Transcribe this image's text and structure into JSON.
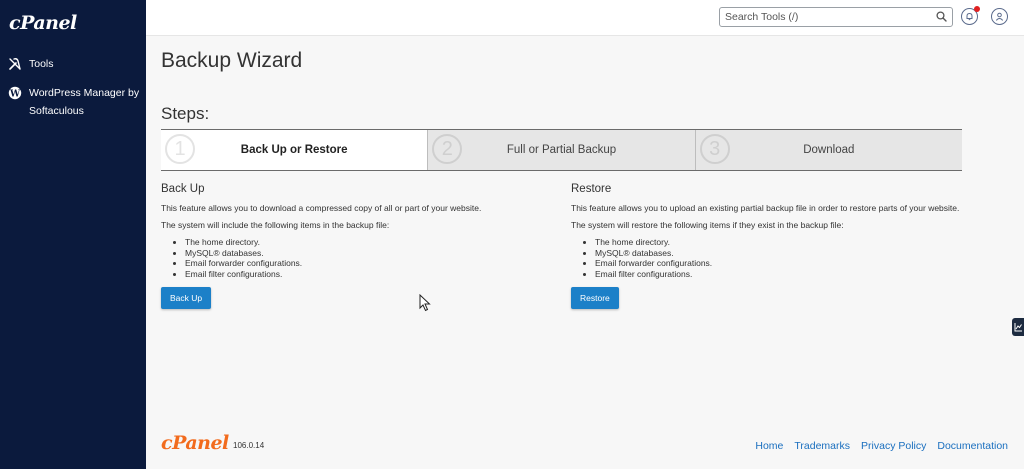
{
  "brand": {
    "logo_text": "cPanel"
  },
  "sidebar": {
    "items": [
      {
        "label": "Tools",
        "icon": "tools-icon"
      },
      {
        "label": "WordPress Manager by Softaculous",
        "icon": "wordpress-icon"
      }
    ]
  },
  "topbar": {
    "search_placeholder": "Search Tools (/)",
    "search_value": "",
    "notifications_has_badge": true,
    "colors": {
      "badge": "#e02020"
    }
  },
  "page": {
    "title": "Backup Wizard",
    "steps_heading": "Steps:",
    "steps": [
      {
        "number": "1",
        "label": "Back Up or Restore",
        "active": true
      },
      {
        "number": "2",
        "label": "Full or Partial Backup",
        "active": false
      },
      {
        "number": "3",
        "label": "Download",
        "active": false
      }
    ],
    "backup": {
      "heading": "Back Up",
      "description": "This feature allows you to download a compressed copy of all or part of your website.",
      "includes_intro": "The system will include the following items in the backup file:",
      "items": [
        "The home directory.",
        "MySQL® databases.",
        "Email forwarder configurations.",
        "Email filter configurations."
      ],
      "button_label": "Back Up"
    },
    "restore": {
      "heading": "Restore",
      "description": "This feature allows you to upload an existing partial backup file in order to restore parts of your website.",
      "includes_intro": "The system will restore the following items if they exist in the backup file:",
      "items": [
        "The home directory.",
        "MySQL® databases.",
        "Email forwarder configurations.",
        "Email filter configurations."
      ],
      "button_label": "Restore"
    }
  },
  "footer": {
    "logo_text": "cPanel",
    "version": "106.0.14",
    "links": [
      "Home",
      "Trademarks",
      "Privacy Policy",
      "Documentation"
    ]
  },
  "colors": {
    "sidebar_bg": "#0b1a3d",
    "primary_button": "#1c80c8",
    "footer_logo": "#f26b1d",
    "link": "#1a6fbf"
  }
}
